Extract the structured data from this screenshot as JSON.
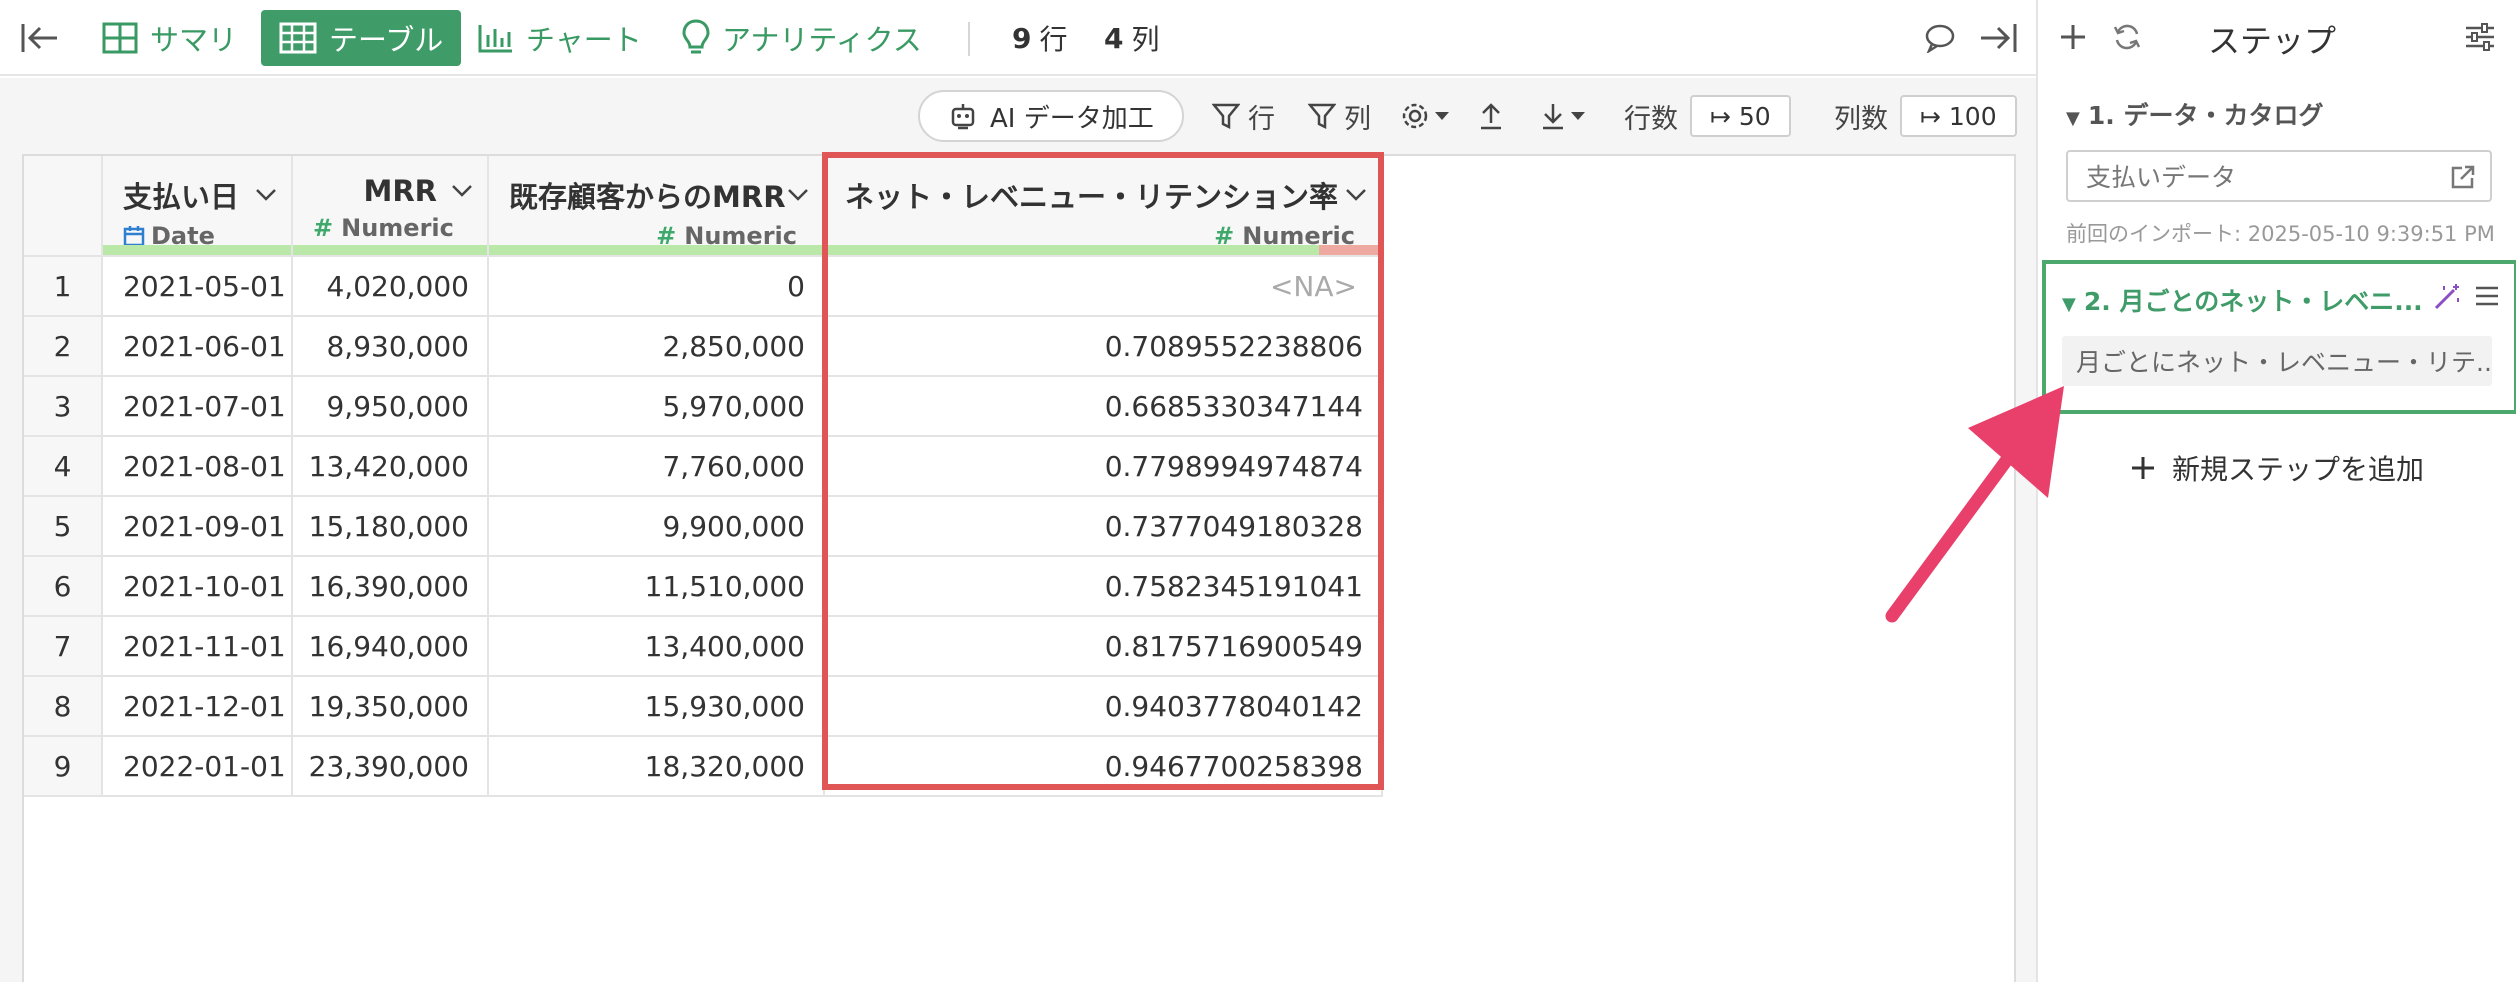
{
  "toolbar": {
    "summary": "サマリ",
    "table": "テーブル",
    "chart": "チャート",
    "analytics": "アナリティクス",
    "rows_count": "9",
    "rows_unit": "行",
    "cols_count": "4",
    "cols_unit": "列"
  },
  "subtoolbar": {
    "ai_label": "AI データ加工",
    "row_filter": "行",
    "col_filter": "列",
    "rows_label": "行数",
    "rows_value": "↦ 50",
    "cols_label": "列数",
    "cols_value": "↦ 100"
  },
  "table": {
    "columns": [
      {
        "name": "支払い日",
        "type": "Date"
      },
      {
        "name": "MRR",
        "type": "Numeric"
      },
      {
        "name": "既存顧客からのMRR",
        "type": "Numeric"
      },
      {
        "name": "ネット・レベニュー・リテンション率",
        "type": "Numeric"
      }
    ],
    "rows": [
      [
        "1",
        "2021-05-01",
        "4,020,000",
        "0",
        "<NA>"
      ],
      [
        "2",
        "2021-06-01",
        "8,930,000",
        "2,850,000",
        "0.7089552238806"
      ],
      [
        "3",
        "2021-07-01",
        "9,950,000",
        "5,970,000",
        "0.6685330347144"
      ],
      [
        "4",
        "2021-08-01",
        "13,420,000",
        "7,760,000",
        "0.7798994974874"
      ],
      [
        "5",
        "2021-09-01",
        "15,180,000",
        "9,900,000",
        "0.7377049180328"
      ],
      [
        "6",
        "2021-10-01",
        "16,390,000",
        "11,510,000",
        "0.7582345191041"
      ],
      [
        "7",
        "2021-11-01",
        "16,940,000",
        "13,400,000",
        "0.8175716900549"
      ],
      [
        "8",
        "2021-12-01",
        "19,350,000",
        "15,930,000",
        "0.9403778040142"
      ],
      [
        "9",
        "2022-01-01",
        "23,390,000",
        "18,320,000",
        "0.9467700258398"
      ]
    ]
  },
  "steps_panel": {
    "title": "ステップ",
    "step1": {
      "title": "1. データ・カタログ",
      "source": "支払いデータ",
      "import_info": "前回のインポート: 2025-05-10 9:39:51 PM"
    },
    "step2": {
      "title": "2. 月ごとのネット・レベニ...",
      "description": "月ごとにネット・レベニュー・リテ..."
    },
    "add_step": "新規ステップを追加"
  },
  "colors": {
    "accent_green": "#3f9c68",
    "highlight_red": "#e05556",
    "arrow_pink": "#e8406a"
  }
}
